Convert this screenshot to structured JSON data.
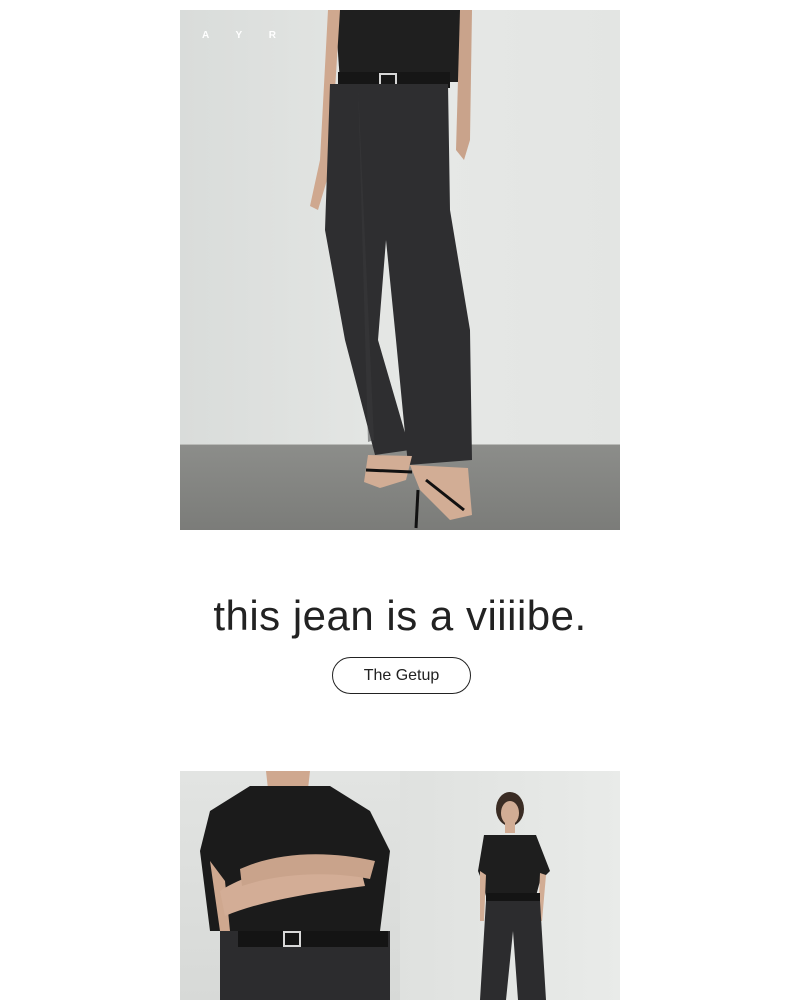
{
  "brand": {
    "logo_text": "A Y R"
  },
  "hero": {
    "image_name": "model-in-black-jeans"
  },
  "headline": "this jean is a viiiibe.",
  "cta": {
    "label": "The Getup"
  },
  "gallery": {
    "left_image": "crossed-arms-closeup",
    "right_image": "full-body-model"
  }
}
